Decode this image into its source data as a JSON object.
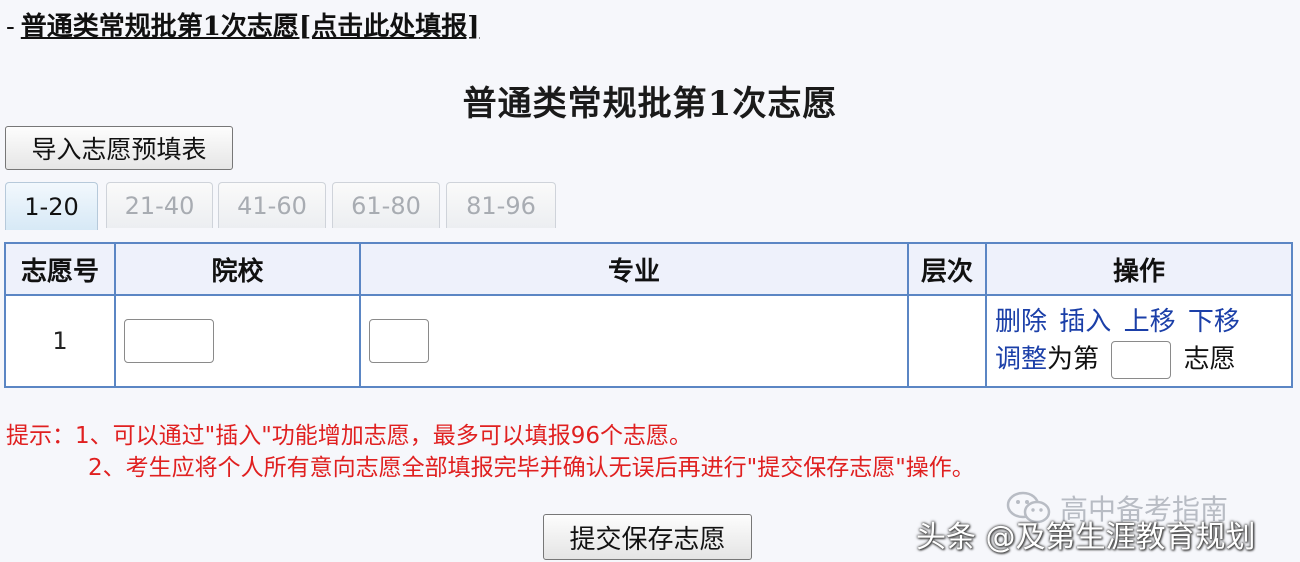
{
  "header": {
    "dash": "-",
    "link_text": "普通类常规批第1次志愿[点击此处填报]"
  },
  "page_title": "普通类常规批第1次志愿",
  "import_button": "导入志愿预填表",
  "tabs": [
    {
      "label": "1-20",
      "active": true
    },
    {
      "label": "21-40",
      "active": false
    },
    {
      "label": "41-60",
      "active": false
    },
    {
      "label": "61-80",
      "active": false
    },
    {
      "label": "81-96",
      "active": false
    }
  ],
  "table": {
    "headers": [
      "志愿号",
      "院校",
      "专业",
      "层次",
      "操作"
    ],
    "rows": [
      {
        "number": "1",
        "school_value": "",
        "major_value": "",
        "level": "",
        "actions": {
          "delete": "删除",
          "insert": "插入",
          "move_up": "上移",
          "move_down": "下移",
          "adjust": "调整",
          "to_text": "为第",
          "position_value": "",
          "suffix": "志愿"
        }
      }
    ]
  },
  "tips": {
    "line1": "提示：1、可以通过\"插入\"功能增加志愿，最多可以填报96个志愿。",
    "line2": "2、考生应将个人所有意向志愿全部填报完毕并确认无误后再进行\"提交保存志愿\"操作。"
  },
  "submit_button": "提交保存志愿",
  "watermark": {
    "top_text": "高中备考指南",
    "bottom_text": "头条 @及第生涯教育规划",
    "icon": "wechat-icon"
  },
  "colors": {
    "link_blue": "#1b3fa8",
    "tip_red": "#e02020",
    "table_border": "#5b86c4",
    "header_bg": "#eef1fb"
  }
}
